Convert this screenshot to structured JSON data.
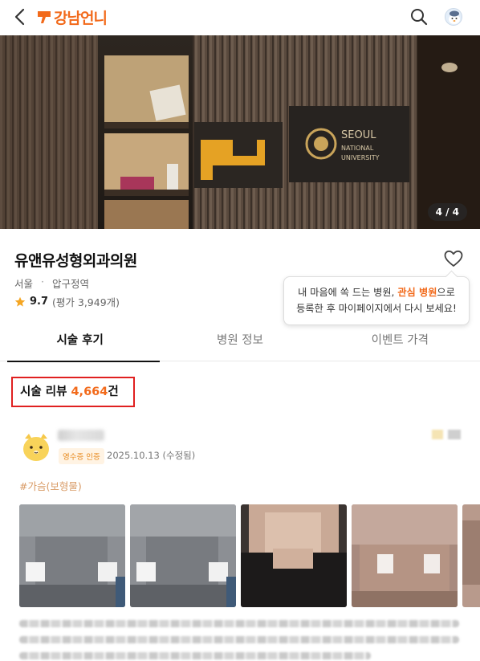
{
  "app": {
    "name": "강남언니"
  },
  "hero": {
    "counter": "4 / 4"
  },
  "hospital": {
    "name": "유앤유성형외과의원",
    "region": "서울",
    "station": "압구정역",
    "rating": "9.7",
    "rating_count": "(평가 3,949개)"
  },
  "tooltip": {
    "before": "내 마음에 쏙 드는 병원, ",
    "highlight": "관심 병원",
    "after": "으로",
    "line2": "등록한 후 마이페이지에서 다시 보세요!"
  },
  "tabs": [
    {
      "label": "시술 후기",
      "active": true
    },
    {
      "label": "병원 정보",
      "active": false
    },
    {
      "label": "이벤트 가격",
      "active": false
    }
  ],
  "reviews": {
    "count_prefix": "시술 리뷰 ",
    "count": "4,664",
    "count_suffix": "건",
    "first": {
      "badge": "영수증 인증",
      "date": "2025.10.13 (수정됨)",
      "tag": "#가슴(보형물)"
    }
  },
  "colors": {
    "accent": "#f26a1b",
    "highlight_border": "#e02020"
  }
}
